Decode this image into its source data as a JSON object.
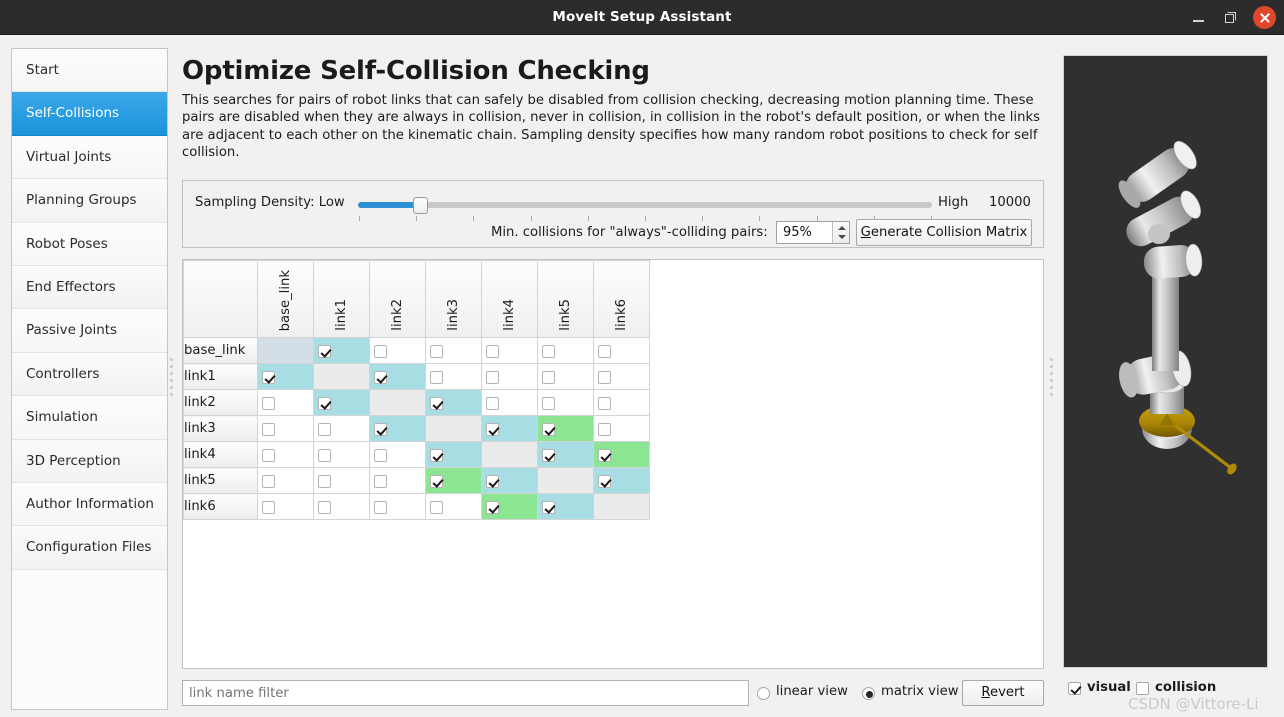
{
  "window": {
    "title": "MoveIt Setup Assistant",
    "minimize_label": "minimize",
    "maximize_label": "restore",
    "close_label": "close"
  },
  "sidebar": {
    "items": [
      {
        "label": "Start",
        "selected": false
      },
      {
        "label": "Self-Collisions",
        "selected": true
      },
      {
        "label": "Virtual Joints",
        "selected": false
      },
      {
        "label": "Planning Groups",
        "selected": false
      },
      {
        "label": "Robot Poses",
        "selected": false
      },
      {
        "label": "End Effectors",
        "selected": false
      },
      {
        "label": "Passive Joints",
        "selected": false
      },
      {
        "label": "Controllers",
        "selected": false
      },
      {
        "label": "Simulation",
        "selected": false
      },
      {
        "label": "3D Perception",
        "selected": false
      },
      {
        "label": "Author Information",
        "selected": false
      },
      {
        "label": "Configuration Files",
        "selected": false
      }
    ]
  },
  "main": {
    "title": "Optimize Self-Collision Checking",
    "description": "This searches for pairs of robot links that can safely be disabled from collision checking, decreasing motion planning time. These pairs are disabled when they are always in collision, never in collision, in collision in the robot's default position, or when the links are adjacent to each other on the kinematic chain. Sampling density specifies how many random robot positions to check for self collision."
  },
  "sampling": {
    "label": "Sampling Density: Low",
    "slider_low_label": "Low",
    "slider_high_label": "High",
    "slider_value_text": "10000",
    "slider_percent": 10.8,
    "min_collisions_label": "Min. collisions for \"always\"-colliding pairs:",
    "min_collisions_value": "95%",
    "generate_button_accel": "G",
    "generate_button_rest": "enerate Collision Matrix"
  },
  "matrix": {
    "columns": [
      "base_link",
      "link1",
      "link2",
      "link3",
      "link4",
      "link5",
      "link6"
    ],
    "rows": [
      {
        "label": "base_link",
        "cells": [
          {
            "state": "diag-selected",
            "checked": false
          },
          {
            "state": "blue",
            "checked": true
          },
          {
            "state": "plain",
            "checked": false
          },
          {
            "state": "plain",
            "checked": false
          },
          {
            "state": "plain",
            "checked": false
          },
          {
            "state": "plain",
            "checked": false
          },
          {
            "state": "plain",
            "checked": false
          }
        ]
      },
      {
        "label": "link1",
        "cells": [
          {
            "state": "blue",
            "checked": true
          },
          {
            "state": "diag",
            "checked": false
          },
          {
            "state": "blue",
            "checked": true
          },
          {
            "state": "plain",
            "checked": false
          },
          {
            "state": "plain",
            "checked": false
          },
          {
            "state": "plain",
            "checked": false
          },
          {
            "state": "plain",
            "checked": false
          }
        ]
      },
      {
        "label": "link2",
        "cells": [
          {
            "state": "plain",
            "checked": false
          },
          {
            "state": "blue",
            "checked": true
          },
          {
            "state": "diag",
            "checked": false
          },
          {
            "state": "blue",
            "checked": true
          },
          {
            "state": "plain",
            "checked": false
          },
          {
            "state": "plain",
            "checked": false
          },
          {
            "state": "plain",
            "checked": false
          }
        ]
      },
      {
        "label": "link3",
        "cells": [
          {
            "state": "plain",
            "checked": false
          },
          {
            "state": "plain",
            "checked": false
          },
          {
            "state": "blue",
            "checked": true
          },
          {
            "state": "diag",
            "checked": false
          },
          {
            "state": "blue",
            "checked": true
          },
          {
            "state": "green",
            "checked": true
          },
          {
            "state": "plain",
            "checked": false
          }
        ]
      },
      {
        "label": "link4",
        "cells": [
          {
            "state": "plain",
            "checked": false
          },
          {
            "state": "plain",
            "checked": false
          },
          {
            "state": "plain",
            "checked": false
          },
          {
            "state": "blue",
            "checked": true
          },
          {
            "state": "diag",
            "checked": false
          },
          {
            "state": "blue",
            "checked": true
          },
          {
            "state": "green",
            "checked": true
          }
        ]
      },
      {
        "label": "link5",
        "cells": [
          {
            "state": "plain",
            "checked": false
          },
          {
            "state": "plain",
            "checked": false
          },
          {
            "state": "plain",
            "checked": false
          },
          {
            "state": "green",
            "checked": true
          },
          {
            "state": "blue",
            "checked": true
          },
          {
            "state": "diag",
            "checked": false
          },
          {
            "state": "blue",
            "checked": true
          }
        ]
      },
      {
        "label": "link6",
        "cells": [
          {
            "state": "plain",
            "checked": false
          },
          {
            "state": "plain",
            "checked": false
          },
          {
            "state": "plain",
            "checked": false
          },
          {
            "state": "plain",
            "checked": false
          },
          {
            "state": "green",
            "checked": true
          },
          {
            "state": "blue",
            "checked": true
          },
          {
            "state": "diag",
            "checked": false
          }
        ]
      }
    ]
  },
  "bottom": {
    "filter_placeholder": "link name filter",
    "filter_value": "",
    "linear_view_label": "linear view",
    "matrix_view_label": "matrix view",
    "selected_view": "matrix view",
    "revert_accel": "R",
    "revert_rest": "evert"
  },
  "viewer": {
    "visual_label": "visual",
    "visual_checked": true,
    "collision_label": "collision",
    "collision_checked": false,
    "background_color": "#303030",
    "robot_color": "#d4d4d4",
    "marker_color": "#b08c06"
  },
  "watermark": {
    "text": "CSDN @Vittore-Li"
  },
  "colors": {
    "accent": "#1b93da",
    "cell_blue": "#a8dde4",
    "cell_green": "#8ce592",
    "cell_diagonal": "#ebebeb",
    "cell_diagonal_selected": "#d3dee6",
    "slider_fill": "#2e8fd6",
    "titlebar": "#2c2c2c",
    "close_button": "#e0462c"
  }
}
